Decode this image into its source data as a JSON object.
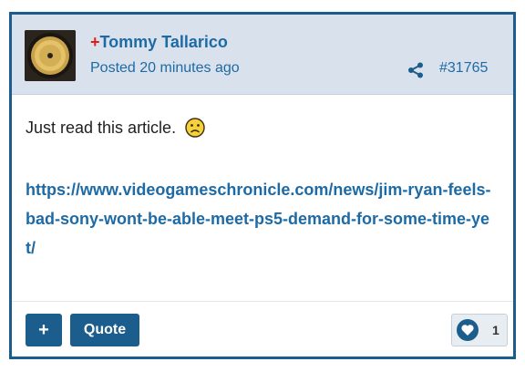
{
  "post": {
    "author_prefix": "+",
    "author_name": "Tommy Tallarico",
    "posted": "Posted 20 minutes ago",
    "post_number": "#31765",
    "body_text": "Just read this article.",
    "link_text": "https://www.videogameschronicle.com/news/jim-ryan-feels-bad-sony-wont-be-able-meet-ps5-demand-for-some-time-yet/",
    "emoji": "frowning-face",
    "avatar": "gold-vinyl-record"
  },
  "footer": {
    "plus_label": "+",
    "quote_label": "Quote",
    "like_count": "1"
  },
  "colors": {
    "accent": "#1b5d8c",
    "link": "#1e6aa5",
    "prefix_red": "#e61b1b",
    "header_bg": "#d9e2ec"
  },
  "icons": {
    "share": "share-icon",
    "like": "heart-icon"
  }
}
